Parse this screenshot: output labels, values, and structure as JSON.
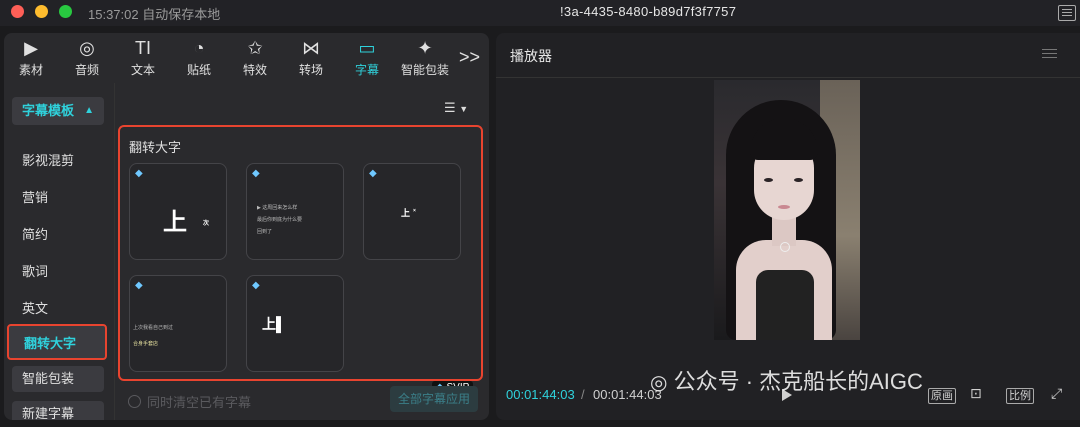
{
  "titlebar": {
    "autosave_text": "15:37:02 自动保存本地",
    "doc_title": "!3a-4435-8480-b89d7f3f7757"
  },
  "toolbar": {
    "tabs": [
      {
        "label": "素材",
        "icon": "media-icon"
      },
      {
        "label": "音频",
        "icon": "audio-icon"
      },
      {
        "label": "文本",
        "icon": "text-icon"
      },
      {
        "label": "贴纸",
        "icon": "sticker-icon"
      },
      {
        "label": "特效",
        "icon": "effects-icon"
      },
      {
        "label": "转场",
        "icon": "transition-icon"
      },
      {
        "label": "字幕",
        "icon": "subtitle-icon",
        "active": true
      },
      {
        "label": "智能包装",
        "icon": "smart-package-icon"
      }
    ],
    "more_label": ">>"
  },
  "sidebar": {
    "header": "字幕模板",
    "items": [
      "影视混剪",
      "营销",
      "简约",
      "歌词",
      "英文",
      "翻转大字",
      "智能包装",
      "新建字幕"
    ],
    "selected": "翻转大字"
  },
  "templates": {
    "section_title": "翻转大字",
    "cards": [
      {
        "big": "上",
        "small": "次"
      },
      {
        "lines": [
          "▶ 这周回来怎么样",
          "最后你到底为什么要",
          "回到了"
        ]
      },
      {
        "big": "上",
        "small": "×"
      },
      {
        "lines": [
          "上次我看自己到过",
          "合身手套店"
        ]
      },
      {
        "big": "上▌"
      }
    ],
    "svip_badge": "SVIP",
    "clear_option": "同时清空已有字幕",
    "apply_all": "全部字幕应用"
  },
  "player": {
    "title": "播放器",
    "current_time": "00:01:44:03",
    "separator": "/",
    "total_time": "00:01:44:03",
    "original_label": "原画",
    "ratio_label": "比例"
  },
  "watermark": {
    "text": "公众号 · 杰克船长的AIGC"
  },
  "colors": {
    "accent": "#2fd2dc",
    "highlight_border": "#e8442f",
    "panel_bg": "#2a2a2d"
  }
}
